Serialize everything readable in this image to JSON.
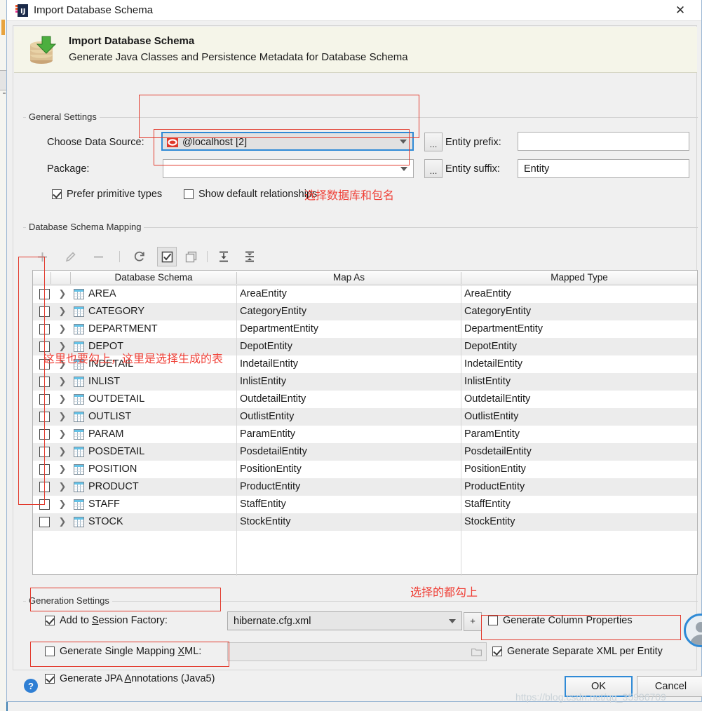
{
  "window": {
    "title": "Import Database Schema",
    "icon": "intellij-idea-icon",
    "close_label": "✕"
  },
  "banner": {
    "icon": "database-import-icon",
    "title": "Import Database Schema",
    "subtitle": "Generate Java Classes and Persistence Metadata for Database Schema"
  },
  "general_settings": {
    "group_label": "General Settings",
    "data_source_label": "Choose Data Source:",
    "data_source_value": "@localhost [2]",
    "data_source_icon": "oracle-datasource-icon",
    "data_source_browse": "...",
    "package_label": "Package:",
    "package_value": "",
    "package_browse": "...",
    "entity_prefix_label": "Entity prefix:",
    "entity_prefix_value": "",
    "entity_suffix_label": "Entity suffix:",
    "entity_suffix_value": "Entity",
    "prefer_primitive_types": {
      "label": "Prefer primitive types",
      "checked": true
    },
    "show_default_relationships": {
      "label": "Show default relationships",
      "checked": false
    }
  },
  "mapping": {
    "group_label": "Database Schema Mapping",
    "toolbar": [
      {
        "name": "add-button",
        "glyph": "+",
        "enabled": false
      },
      {
        "name": "edit-button",
        "glyph": "✎",
        "enabled": false
      },
      {
        "name": "remove-button",
        "glyph": "−",
        "enabled": false
      },
      {
        "name": "refresh-button",
        "glyph": "↻",
        "enabled": true
      },
      {
        "name": "select-all-button",
        "glyph": "☑",
        "enabled": true
      },
      {
        "name": "deselect-all-button",
        "glyph": "❐",
        "enabled": true
      },
      {
        "name": "expand-all-button",
        "glyph": "↧",
        "enabled": true
      },
      {
        "name": "collapse-all-button",
        "glyph": "⤓",
        "enabled": true
      }
    ],
    "columns": [
      "Database Schema",
      "Map As",
      "Mapped Type"
    ],
    "rows": [
      {
        "checked": false,
        "schema": "AREA",
        "map_as": "AreaEntity",
        "mapped_type": "AreaEntity"
      },
      {
        "checked": false,
        "schema": "CATEGORY",
        "map_as": "CategoryEntity",
        "mapped_type": "CategoryEntity"
      },
      {
        "checked": false,
        "schema": "DEPARTMENT",
        "map_as": "DepartmentEntity",
        "mapped_type": "DepartmentEntity"
      },
      {
        "checked": false,
        "schema": "DEPOT",
        "map_as": "DepotEntity",
        "mapped_type": "DepotEntity"
      },
      {
        "checked": false,
        "schema": "INDETAIL",
        "map_as": "IndetailEntity",
        "mapped_type": "IndetailEntity"
      },
      {
        "checked": false,
        "schema": "INLIST",
        "map_as": "InlistEntity",
        "mapped_type": "InlistEntity"
      },
      {
        "checked": false,
        "schema": "OUTDETAIL",
        "map_as": "OutdetailEntity",
        "mapped_type": "OutdetailEntity"
      },
      {
        "checked": false,
        "schema": "OUTLIST",
        "map_as": "OutlistEntity",
        "mapped_type": "OutlistEntity"
      },
      {
        "checked": false,
        "schema": "PARAM",
        "map_as": "ParamEntity",
        "mapped_type": "ParamEntity"
      },
      {
        "checked": false,
        "schema": "POSDETAIL",
        "map_as": "PosdetailEntity",
        "mapped_type": "PosdetailEntity"
      },
      {
        "checked": false,
        "schema": "POSITION",
        "map_as": "PositionEntity",
        "mapped_type": "PositionEntity"
      },
      {
        "checked": false,
        "schema": "PRODUCT",
        "map_as": "ProductEntity",
        "mapped_type": "ProductEntity"
      },
      {
        "checked": false,
        "schema": "STAFF",
        "map_as": "StaffEntity",
        "mapped_type": "StaffEntity"
      },
      {
        "checked": false,
        "schema": "STOCK",
        "map_as": "StockEntity",
        "mapped_type": "StockEntity"
      }
    ]
  },
  "generation_settings": {
    "group_label": "Generation Settings",
    "add_to_session_factory": {
      "label": "Add to Session Factory:",
      "checked": true
    },
    "session_factory_file": "hibernate.cfg.xml",
    "add_config_button": "+",
    "generate_single_mapping_xml": {
      "label": "Generate Single Mapping XML:",
      "checked": false
    },
    "single_mapping_path": "",
    "browse_icon": "folder-icon",
    "generate_jpa_annotations": {
      "label": "Generate JPA Annotations (Java5)",
      "checked": true
    },
    "generate_column_properties": {
      "label": "Generate Column Properties",
      "checked": false
    },
    "generate_separate_xml": {
      "label": "Generate Separate XML per Entity",
      "checked": true
    }
  },
  "footer": {
    "help_glyph": "?",
    "ok_label": "OK",
    "cancel_label": "Cancel",
    "watermark": "https://blog.csdn.net/qq_35986709"
  },
  "annotations": [
    {
      "name": "annotation-choose-db-package",
      "text": "选择数据库和包名"
    },
    {
      "name": "annotation-check-tables",
      "text": "这里也要勾上，这里是选择生成的表"
    },
    {
      "name": "annotation-check-all-selected",
      "text": "选择的都勾上"
    }
  ],
  "colors": {
    "accent": "#2f8ad6",
    "annotation_red": "#ef3f36",
    "banner_bg": "#f5f5e9",
    "dialog_bg": "#f0f0f0"
  }
}
